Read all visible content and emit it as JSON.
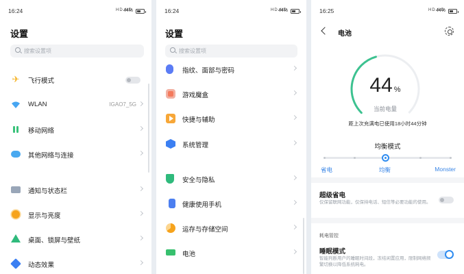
{
  "screen1": {
    "time": "16:24",
    "status_right": "HD HD",
    "battery_label": "44%",
    "title": "设置",
    "search_placeholder": "搜索设置项",
    "items": [
      {
        "label": "飞行模式"
      },
      {
        "label": "WLAN",
        "value": "IGAO7_5G"
      },
      {
        "label": "移动网络"
      },
      {
        "label": "其他网络与连接"
      },
      {
        "label": "通知与状态栏"
      },
      {
        "label": "显示与亮度"
      },
      {
        "label": "桌面、锁屏与壁纸"
      },
      {
        "label": "动态效果"
      }
    ]
  },
  "screen2": {
    "time": "16:24",
    "status_right": "HD HD",
    "battery_label": "44%",
    "title": "设置",
    "search_placeholder": "搜索设置项",
    "items": [
      {
        "label": "指纹、面部与密码"
      },
      {
        "label": "游戏魔盒"
      },
      {
        "label": "快捷与辅助"
      },
      {
        "label": "系统管理"
      },
      {
        "label": "安全与隐私"
      },
      {
        "label": "健康使用手机"
      },
      {
        "label": "运存与存储空间"
      },
      {
        "label": "电池"
      }
    ]
  },
  "screen3": {
    "time": "16:25",
    "status_right": "HD HD",
    "battery_label": "44%",
    "header": "电池",
    "battery_level": 44,
    "percent_value": "44",
    "percent_unit": "%",
    "current_caption": "当前电量",
    "remaining": "距上次充满电已使用18小时44分钟",
    "mode_title": "均衡模式",
    "modes": [
      "省电",
      "均衡",
      "Monster"
    ],
    "selected_mode": "均衡",
    "super_saver": {
      "title": "超级省电",
      "desc": "仅保留联网功能，仅保持电话、短信等必要功能的使用。"
    },
    "section_label": "耗电管控",
    "sleep_mode": {
      "title": "睡眠模式",
      "desc": "智能判断用户的睡眠时间段，冻结闲置应用，限制网络频繁切换以降低系统耗电。",
      "enabled": true
    }
  },
  "colors": {
    "accent": "#2f8cf0",
    "ring_green": "#3cc290",
    "ring_track": "#eceef1"
  }
}
